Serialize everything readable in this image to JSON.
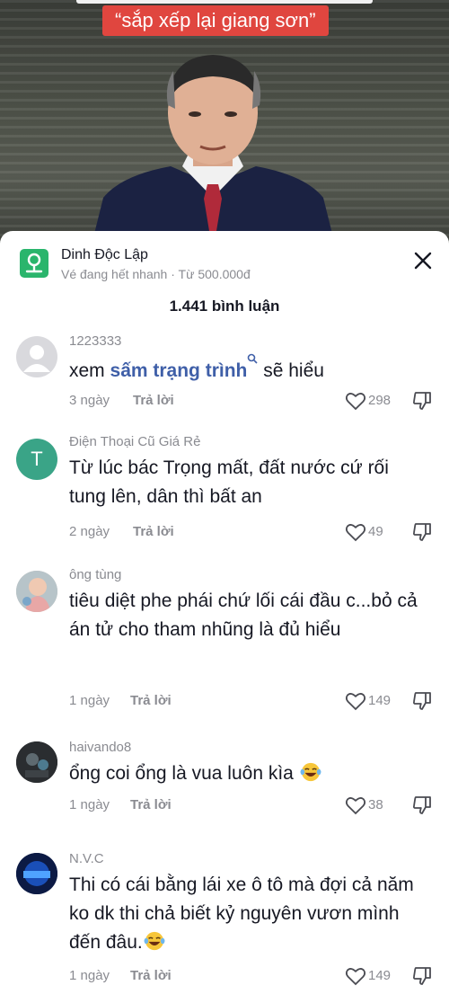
{
  "video": {
    "caption": "“sắp xếp lại giang sơn”"
  },
  "anchor": {
    "title": "Dinh Độc Lập",
    "subtitle": "Vé đang hết nhanh · Từ 500.000đ",
    "icon": "map-pin-icon"
  },
  "comments_header": {
    "count_label": "1.441 bình luận"
  },
  "colors": {
    "caption_bg": "#e0463f",
    "anchor_icon_bg": "#2ab56c",
    "search_link": "#3f5fa8",
    "secondary_text": "#8a8b91"
  },
  "reply_label": "Trả lời",
  "comments": [
    {
      "username": "1223333",
      "text_before": "xem ",
      "link_text": "sấm trạng trình",
      "text_after": " sẽ hiểu",
      "time": "3 ngày",
      "likes": "298",
      "avatar": "default-avatar"
    },
    {
      "username": "Điện Thoại Cũ Giá Rẻ",
      "avatar_letter": "T",
      "text": "Từ lúc bác Trọng mất, đất nước cứ rối tung lên, dân thì bất an",
      "time": "2 ngày",
      "likes": "49"
    },
    {
      "username": "ông tùng",
      "text": "tiêu diệt phe phái chứ lối cái đầu c...bỏ cả án tử cho tham nhũng là đủ hiểu",
      "time": "1 ngày",
      "likes": "149"
    },
    {
      "username": "haivando8",
      "text": "ổng coi ổng là vua luôn kìa",
      "emoji": "laughing-emoji",
      "time": "1 ngày",
      "likes": "38"
    },
    {
      "username": "N.V.C",
      "text": "Thi có cái bằng lái xe ô tô mà đợi cả năm ko dk thi chả biết kỷ nguyên vươn mình đến đâu.",
      "emoji": "laughing-emoji",
      "time": "1 ngày",
      "likes": "149"
    }
  ]
}
